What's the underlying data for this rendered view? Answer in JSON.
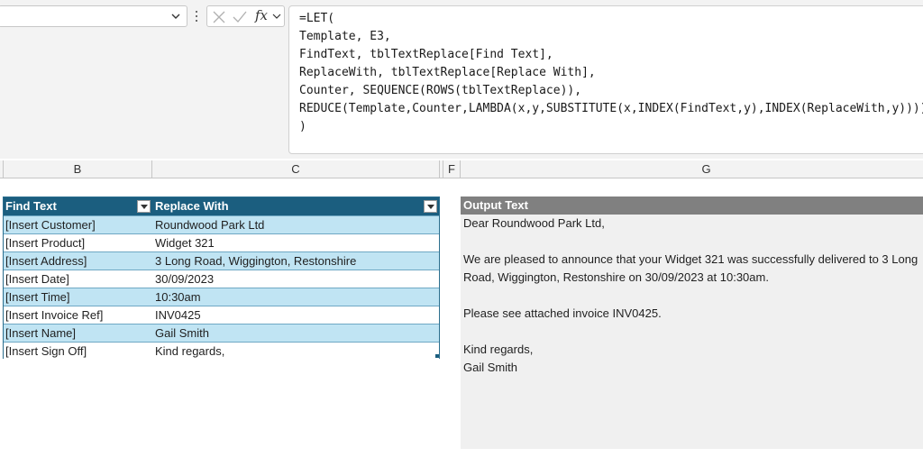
{
  "formula_bar": {
    "fx_label": "fx",
    "lines": [
      "=LET(",
      "Template, E3,",
      "FindText, tblTextReplace[Find Text],",
      "ReplaceWith, tblTextReplace[Replace With],",
      "Counter, SEQUENCE(ROWS(tblTextReplace)),",
      "REDUCE(Template,Counter,LAMBDA(x,y,SUBSTITUTE(x,INDEX(FindText,y),INDEX(ReplaceWith,y))))",
      ")"
    ]
  },
  "columns": [
    "B",
    "C",
    "F",
    "G"
  ],
  "table": {
    "headers": [
      "Find Text",
      "Replace With"
    ],
    "rows": [
      [
        "[Insert Customer]",
        "Roundwood Park Ltd"
      ],
      [
        "[Insert Product]",
        "Widget 321"
      ],
      [
        "[Insert Address]",
        "3 Long Road, Wiggington, Restonshire"
      ],
      [
        "[Insert Date]",
        "30/09/2023"
      ],
      [
        "[Insert Time]",
        "10:30am"
      ],
      [
        "[Insert Invoice Ref]",
        "INV0425"
      ],
      [
        "[Insert Name]",
        "Gail Smith"
      ],
      [
        "[Insert Sign Off]",
        "Kind regards,"
      ]
    ]
  },
  "output": {
    "header": "Output Text",
    "lines": [
      "Dear Roundwood Park Ltd,",
      "",
      "We are pleased to announce that your Widget 321 was successfully delivered to 3 Long",
      "Road, Wiggington, Restonshire on 30/09/2023 at 10:30am.",
      "",
      "Please see attached invoice INV0425.",
      "",
      "Kind regards,",
      "Gail Smith"
    ]
  },
  "colors": {
    "table_header": "#1b5e7f",
    "table_band": "#c0e4f3",
    "output_header": "#808080",
    "output_body": "#f0f0f0"
  }
}
